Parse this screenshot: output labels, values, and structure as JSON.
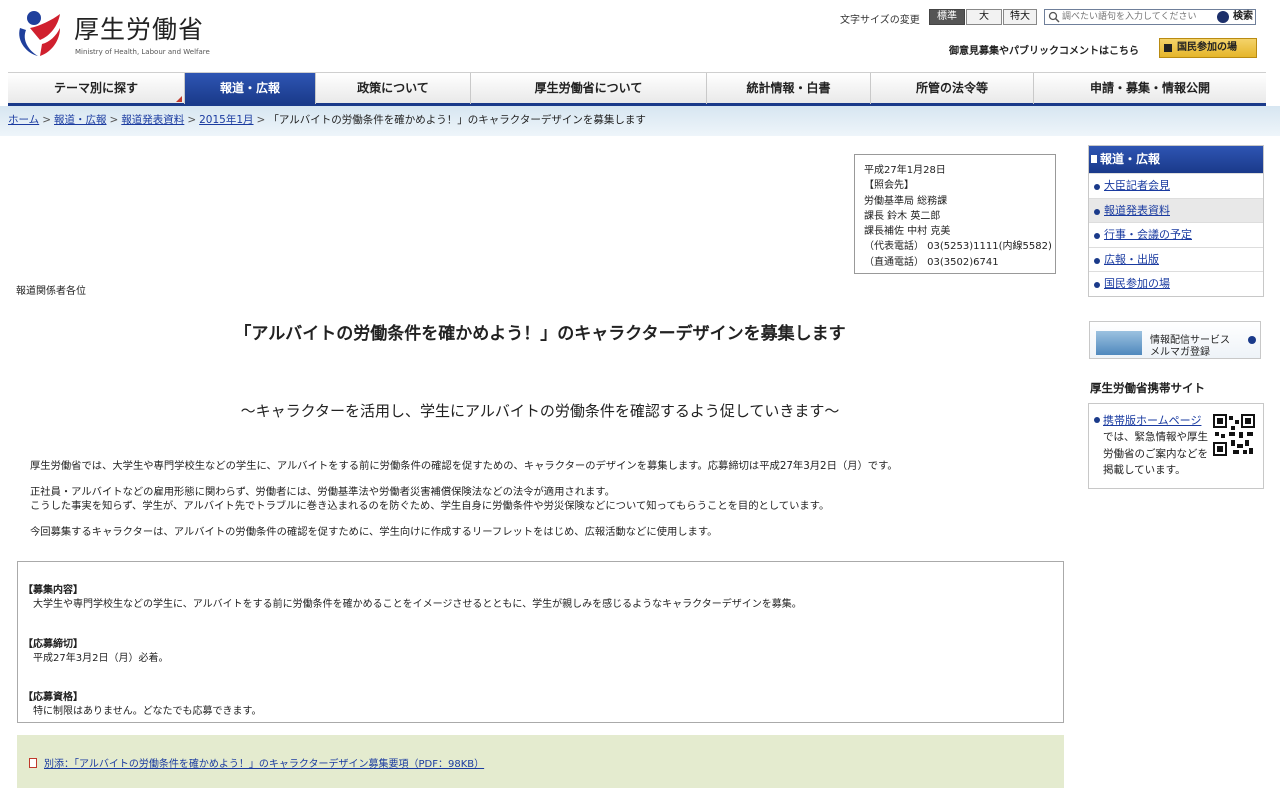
{
  "header": {
    "logo_text": "厚生労働省",
    "logo_sub": "Ministry of Health, Labour and Welfare",
    "font_size_label": "文字サイズの変更",
    "font_sizes": [
      "標準",
      "大",
      "特大"
    ],
    "search_placeholder": "調べたい語句を入力してください",
    "search_button": "検索",
    "opinion_link": "御意見募集やパブリックコメントはこちら",
    "participate_button": "国民参加の場"
  },
  "nav": [
    {
      "label": "テーマ別に探す"
    },
    {
      "label": "報道・広報"
    },
    {
      "label": "政策について"
    },
    {
      "label": "厚生労働省について"
    },
    {
      "label": "統計情報・白書"
    },
    {
      "label": "所管の法令等"
    },
    {
      "label": "申請・募集・情報公開"
    }
  ],
  "breadcrumb": {
    "items": [
      "ホーム",
      "報道・広報",
      "報道発表資料",
      "2015年1月"
    ],
    "current": "「アルバイトの労働条件を確かめよう！」のキャラクターデザインを募集します"
  },
  "contact": {
    "lines": [
      "平成27年1月28日",
      "【照会先】",
      "労働基準局 総務課",
      "課長 鈴木 英二郎",
      "課長補佐 中村 克美",
      "（代表電話） 03(5253)1111(内線5582)",
      "（直通電話） 03(3502)6741"
    ]
  },
  "main": {
    "recipients": "報道関係者各位",
    "title": "「アルバイトの労働条件を確かめよう！」のキャラクターデザインを募集します",
    "subtitle": "～キャラクターを活用し、学生にアルバイトの労働条件を確認するよう促していきます～",
    "paragraphs": [
      "厚生労働省では、大学生や専門学校生などの学生に、アルバイトをする前に労働条件の確認を促すための、キャラクターのデザインを募集します。応募締切は平成27年3月2日（月）です。",
      "正社員・アルバイトなどの雇用形態に関わらず、労働者には、労働基準法や労働者災害補償保険法などの法令が適用されます。",
      "こうした事実を知らず、学生が、アルバイト先でトラブルに巻き込まれるのを防ぐため、学生自身に労働条件や労災保険などについて知ってもらうことを目的としています。",
      "今回募集するキャラクターは、アルバイトの労働条件の確認を促すために、学生向けに作成するリーフレットをはじめ、広報活動などに使用します。"
    ],
    "details": [
      {
        "head": "【募集内容】",
        "body": "大学生や専門学校生などの学生に、アルバイトをする前に労働条件を確かめることをイメージさせるとともに、学生が親しみを感じるようなキャラクターデザインを募集。"
      },
      {
        "head": "【応募締切】",
        "body": "平成27年3月2日（月）必着。"
      },
      {
        "head": "【応募資格】",
        "body": "特に制限はありません。どなたでも応募できます。"
      }
    ],
    "attachment": "別添：「アルバイトの労働条件を確かめよう！」のキャラクターデザイン募集要項（PDF：98KB）"
  },
  "sidebar": {
    "head": "報道・広報",
    "items": [
      {
        "label": "大臣記者会見"
      },
      {
        "label": "報道発表資料"
      },
      {
        "label": "行事・会議の予定"
      },
      {
        "label": "広報・出版"
      },
      {
        "label": "国民参加の場"
      }
    ],
    "mail_line1": "情報配信サービス",
    "mail_line2": "メルマガ登録",
    "mobile_title": "厚生労働省携帯サイト",
    "mobile_link": "携帯版ホームページ",
    "mobile_text": "では、緊急情報や厚生労働省のご案内などを掲載しています。"
  },
  "colors": {
    "nav_active": "#1a3a8a",
    "link": "#1a3ba0",
    "attachment_bg": "#e4ebcf",
    "crumb_band": "#d7e6f1"
  }
}
